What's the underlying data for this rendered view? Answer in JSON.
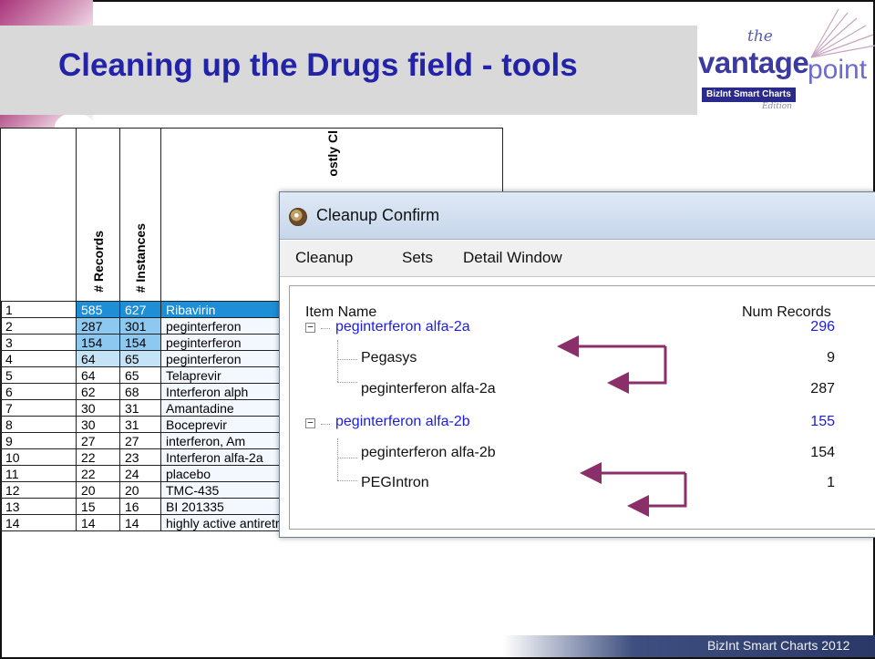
{
  "slide": {
    "title": "Cleaning up the Drugs field - tools",
    "footer": "BizInt Smart Charts 2012"
  },
  "logo": {
    "the": "the",
    "vantage": "vantage",
    "point": "point",
    "badge": "BizInt Smart Charts",
    "edition": "Edition"
  },
  "table": {
    "headers": {
      "records": "# Records",
      "instances": "# Instances",
      "name_partial": "ostly Cl"
    },
    "rows": [
      {
        "idx": "1",
        "records": "585",
        "instances": "627",
        "name": "Ribavirin"
      },
      {
        "idx": "2",
        "records": "287",
        "instances": "301",
        "name": "peginterferon"
      },
      {
        "idx": "3",
        "records": "154",
        "instances": "154",
        "name": "peginterferon"
      },
      {
        "idx": "4",
        "records": "64",
        "instances": "65",
        "name": "peginterferon"
      },
      {
        "idx": "5",
        "records": "64",
        "instances": "65",
        "name": "Telaprevir"
      },
      {
        "idx": "6",
        "records": "62",
        "instances": "68",
        "name": "Interferon alph"
      },
      {
        "idx": "7",
        "records": "30",
        "instances": "31",
        "name": "Amantadine"
      },
      {
        "idx": "8",
        "records": "30",
        "instances": "31",
        "name": "Boceprevir"
      },
      {
        "idx": "9",
        "records": "27",
        "instances": "27",
        "name": "interferon, Am"
      },
      {
        "idx": "10",
        "records": "22",
        "instances": "23",
        "name": "Interferon alfa-2a"
      },
      {
        "idx": "11",
        "records": "22",
        "instances": "24",
        "name": "placebo"
      },
      {
        "idx": "12",
        "records": "20",
        "instances": "20",
        "name": "TMC-435"
      },
      {
        "idx": "13",
        "records": "15",
        "instances": "16",
        "name": "BI 201335"
      },
      {
        "idx": "14",
        "records": "14",
        "instances": "14",
        "name": "highly active antiretroviral therapy"
      }
    ]
  },
  "dialog": {
    "title": "Cleanup Confirm",
    "menu": [
      "Cleanup",
      "Sets",
      "Detail Window"
    ],
    "columns": {
      "item": "Item Name",
      "num": "Num Records"
    },
    "tree": [
      {
        "label": "peginterferon alfa-2a",
        "num": "296",
        "group": true
      },
      {
        "label": "Pegasys",
        "num": "9",
        "group": false
      },
      {
        "label": "peginterferon alfa-2a",
        "num": "287",
        "group": false
      },
      {
        "label": "peginterferon alfa-2b",
        "num": "155",
        "group": true
      },
      {
        "label": "peginterferon alfa-2b",
        "num": "154",
        "group": false
      },
      {
        "label": "PEGIntron",
        "num": "1",
        "group": false
      }
    ],
    "toggle_glyph": "−"
  },
  "colors": {
    "title": "#2323a8",
    "selected_row": "#1e8ed6",
    "arrow": "#8b2f6a",
    "tree_group": "#1c1ce0"
  }
}
